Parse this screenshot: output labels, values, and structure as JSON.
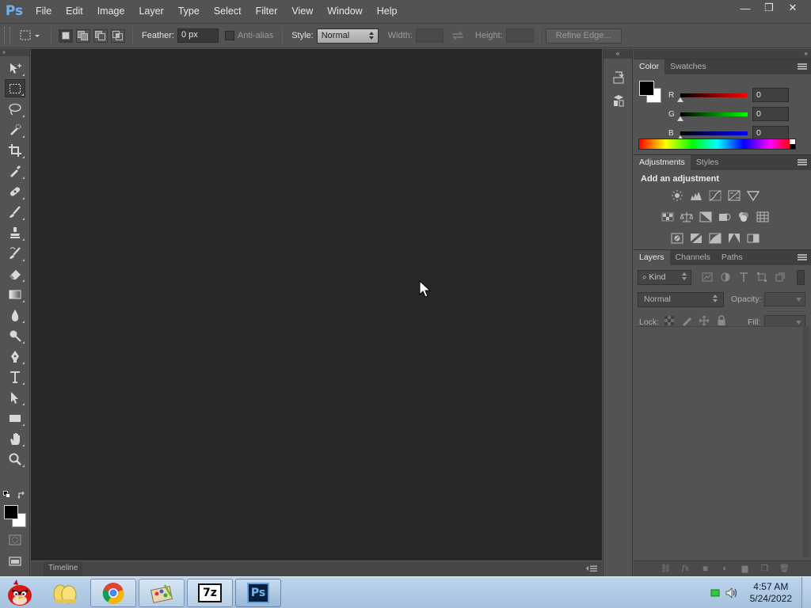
{
  "app": {
    "logo_text": "Ps",
    "menu": [
      "File",
      "Edit",
      "Image",
      "Layer",
      "Type",
      "Select",
      "Filter",
      "View",
      "Window",
      "Help"
    ],
    "window_controls": {
      "minimize": "—",
      "restore": "❐",
      "close": "✕"
    }
  },
  "options_bar": {
    "feather_label": "Feather:",
    "feather_value": "0 px",
    "anti_alias_label": "Anti-alias",
    "style_label": "Style:",
    "style_value": "Normal",
    "width_label": "Width:",
    "height_label": "Height:",
    "refine_edge_label": "Refine Edge..."
  },
  "tools": [
    {
      "name": "move-tool-icon"
    },
    {
      "name": "rectangular-marquee-tool-icon",
      "active": true
    },
    {
      "name": "lasso-tool-icon"
    },
    {
      "name": "quick-selection-tool-icon"
    },
    {
      "name": "crop-tool-icon"
    },
    {
      "name": "eyedropper-tool-icon"
    },
    {
      "name": "spot-healing-brush-tool-icon"
    },
    {
      "name": "brush-tool-icon"
    },
    {
      "name": "clone-stamp-tool-icon"
    },
    {
      "name": "history-brush-tool-icon"
    },
    {
      "name": "eraser-tool-icon"
    },
    {
      "name": "gradient-tool-icon"
    },
    {
      "name": "blur-tool-icon"
    },
    {
      "name": "dodge-tool-icon"
    },
    {
      "name": "pen-tool-icon"
    },
    {
      "name": "type-tool-icon"
    },
    {
      "name": "path-selection-tool-icon"
    },
    {
      "name": "rectangle-tool-icon"
    },
    {
      "name": "hand-tool-icon"
    },
    {
      "name": "zoom-tool-icon"
    }
  ],
  "timeline": {
    "tab_label": "Timeline"
  },
  "color_panel": {
    "tabs": [
      "Color",
      "Swatches"
    ],
    "foreground": "#000000",
    "background": "#ffffff",
    "channels": [
      {
        "label": "R",
        "value": "0",
        "color": "#d10000"
      },
      {
        "label": "G",
        "value": "0",
        "color": "#00b400"
      },
      {
        "label": "B",
        "value": "0",
        "color": "#0000d8"
      }
    ]
  },
  "adjustments_panel": {
    "tabs": [
      "Adjustments",
      "Styles"
    ],
    "heading": "Add an adjustment",
    "icons": [
      "brightness-contrast-icon",
      "levels-icon",
      "curves-icon",
      "exposure-icon",
      "vibrance-icon",
      "hue-saturation-icon",
      "color-balance-icon",
      "black-white-icon",
      "photo-filter-icon",
      "channel-mixer-icon",
      "color-lookup-icon",
      "invert-icon",
      "posterize-icon",
      "threshold-icon",
      "selective-color-icon",
      "gradient-map-icon"
    ]
  },
  "layers_panel": {
    "tabs": [
      "Layers",
      "Channels",
      "Paths"
    ],
    "filter_label": "Kind",
    "blend_mode": "Normal",
    "opacity_label": "Opacity:",
    "lock_label": "Lock:",
    "fill_label": "Fill:",
    "bottom_icons": [
      "link-layers-icon",
      "fx-icon",
      "add-mask-icon",
      "adjustment-layer-icon",
      "new-group-icon",
      "new-layer-icon",
      "delete-layer-icon"
    ]
  },
  "taskbar": {
    "apps": [
      {
        "name": "angry-birds-icon"
      },
      {
        "name": "file-explorer-icon"
      },
      {
        "name": "chrome-icon"
      },
      {
        "name": "paint-app-icon"
      },
      {
        "name": "7zip-icon",
        "text": "7z"
      },
      {
        "name": "photoshop-icon",
        "text": "Ps"
      }
    ],
    "time": "4:57 AM",
    "date": "5/24/2022"
  }
}
